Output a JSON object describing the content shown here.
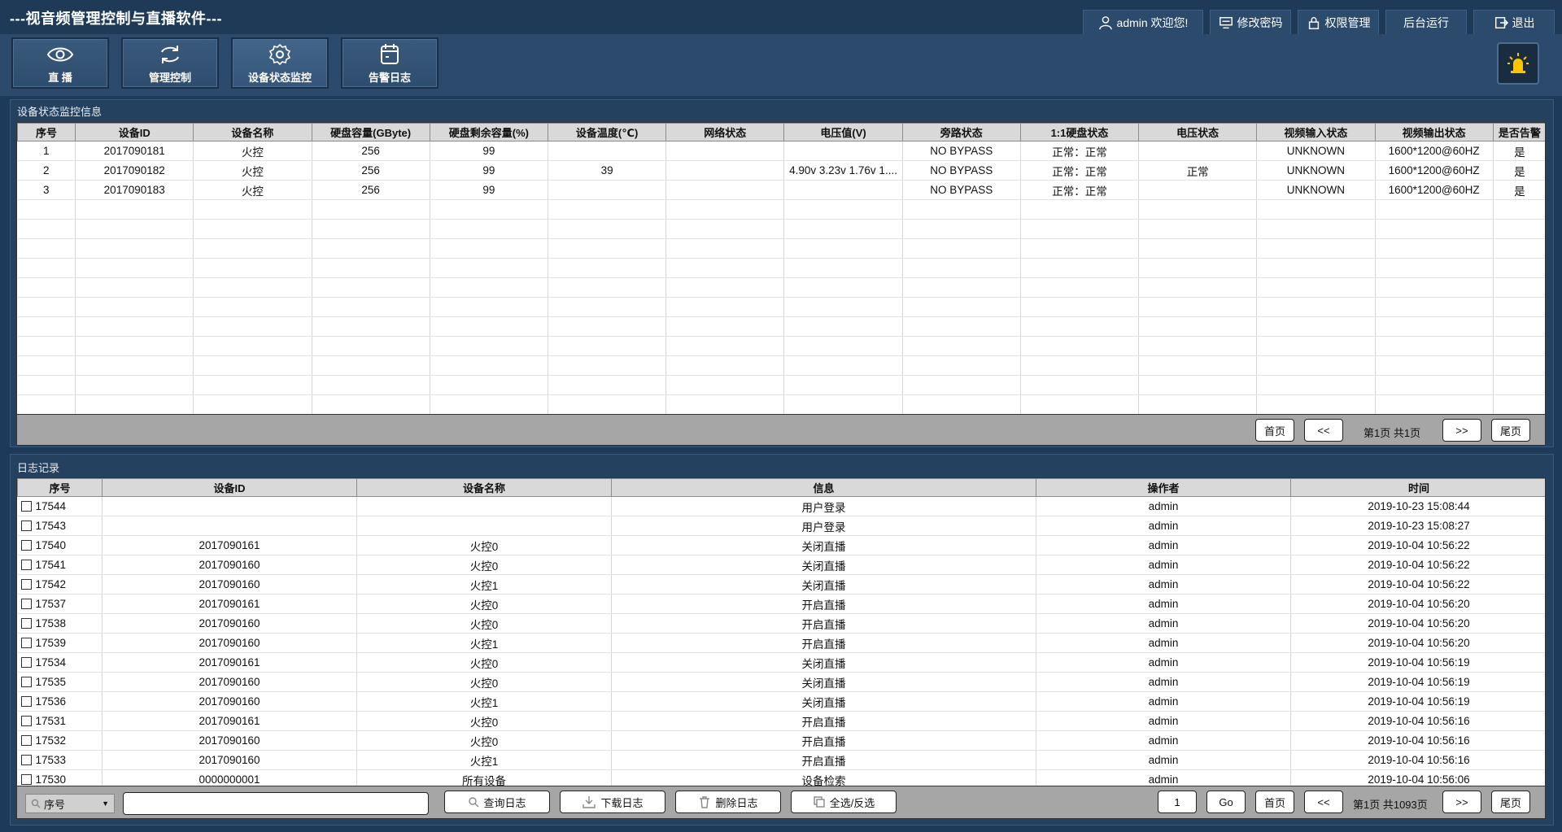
{
  "app": {
    "title": "---视音频管理控制与直播软件---"
  },
  "topbar": {
    "user_label": "admin 欢迎您!",
    "change_password": "修改密码",
    "permission": "权限管理",
    "background_run": "后台运行",
    "logout": "退出"
  },
  "nav": [
    {
      "label": "直  播",
      "icon": "eye-icon"
    },
    {
      "label": "管理控制",
      "icon": "refresh-icon"
    },
    {
      "label": "设备状态监控",
      "icon": "gear-icon"
    },
    {
      "label": "告警日志",
      "icon": "calendar-icon"
    }
  ],
  "status_panel": {
    "title": "设备状态监控信息",
    "columns": [
      "序号",
      "设备ID",
      "设备名称",
      "硬盘容量(GByte)",
      "硬盘剩余容量(%)",
      "设备温度(℃)",
      "网络状态",
      "电压值(V)",
      "旁路状态",
      "1:1硬盘状态",
      "电压状态",
      "视频输入状态",
      "视频输出状态",
      "是否告警"
    ],
    "rows": [
      [
        "1",
        "2017090181",
        "火控",
        "256",
        "99",
        "",
        "",
        "",
        "NO BYPASS",
        "正常：正常",
        "",
        "UNKNOWN",
        "1600*1200@60HZ",
        "是"
      ],
      [
        "2",
        "2017090182",
        "火控",
        "256",
        "99",
        "39",
        "",
        "4.90v 3.23v 1.76v 1....",
        "NO BYPASS",
        "正常：正常",
        "正常",
        "UNKNOWN",
        "1600*1200@60HZ",
        "是"
      ],
      [
        "3",
        "2017090183",
        "火控",
        "256",
        "99",
        "",
        "",
        "",
        "NO BYPASS",
        "正常：正常",
        "",
        "UNKNOWN",
        "1600*1200@60HZ",
        "是"
      ]
    ],
    "pager": {
      "first": "首页",
      "prev": "<<",
      "info": "第1页 共1页",
      "next": ">>",
      "last": "尾页"
    }
  },
  "log_panel": {
    "title": "日志记录",
    "columns": [
      "序号",
      "设备ID",
      "设备名称",
      "信息",
      "操作者",
      "时间"
    ],
    "rows": [
      [
        "17544",
        "",
        "",
        "用户登录",
        "admin",
        "2019-10-23 15:08:44"
      ],
      [
        "17543",
        "",
        "",
        "用户登录",
        "admin",
        "2019-10-23 15:08:27"
      ],
      [
        "17540",
        "2017090161",
        "火控0",
        "关闭直播",
        "admin",
        "2019-10-04 10:56:22"
      ],
      [
        "17541",
        "2017090160",
        "火控0",
        "关闭直播",
        "admin",
        "2019-10-04 10:56:22"
      ],
      [
        "17542",
        "2017090160",
        "火控1",
        "关闭直播",
        "admin",
        "2019-10-04 10:56:22"
      ],
      [
        "17537",
        "2017090161",
        "火控0",
        "开启直播",
        "admin",
        "2019-10-04 10:56:20"
      ],
      [
        "17538",
        "2017090160",
        "火控0",
        "开启直播",
        "admin",
        "2019-10-04 10:56:20"
      ],
      [
        "17539",
        "2017090160",
        "火控1",
        "开启直播",
        "admin",
        "2019-10-04 10:56:20"
      ],
      [
        "17534",
        "2017090161",
        "火控0",
        "关闭直播",
        "admin",
        "2019-10-04 10:56:19"
      ],
      [
        "17535",
        "2017090160",
        "火控0",
        "关闭直播",
        "admin",
        "2019-10-04 10:56:19"
      ],
      [
        "17536",
        "2017090160",
        "火控1",
        "关闭直播",
        "admin",
        "2019-10-04 10:56:19"
      ],
      [
        "17531",
        "2017090161",
        "火控0",
        "开启直播",
        "admin",
        "2019-10-04 10:56:16"
      ],
      [
        "17532",
        "2017090160",
        "火控0",
        "开启直播",
        "admin",
        "2019-10-04 10:56:16"
      ],
      [
        "17533",
        "2017090160",
        "火控1",
        "开启直播",
        "admin",
        "2019-10-04 10:56:16"
      ],
      [
        "17530",
        "0000000001",
        "所有设备",
        "设备检索",
        "admin",
        "2019-10-04 10:56:06"
      ]
    ],
    "search": {
      "field": "序号",
      "value": ""
    },
    "actions": {
      "query": "查询日志",
      "download": "下载日志",
      "delete": "删除日志",
      "select_all": "全选/反选"
    },
    "pager": {
      "page_input": "1",
      "go": "Go",
      "first": "首页",
      "prev": "<<",
      "info": "第1页 共1093页",
      "next": ">>",
      "last": "尾页"
    }
  }
}
